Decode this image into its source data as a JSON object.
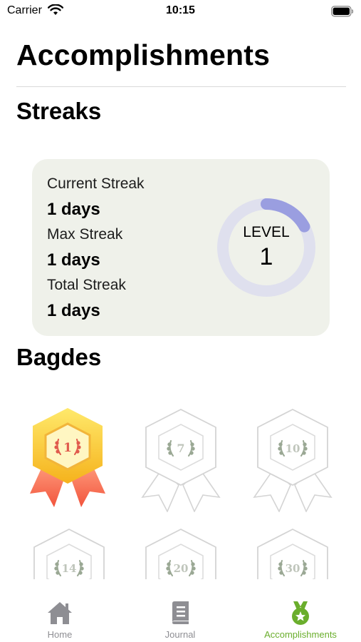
{
  "status_bar": {
    "carrier": "Carrier",
    "time": "10:15"
  },
  "title": "Accomplishments",
  "streaks": {
    "section_title": "Streaks",
    "current_label": "Current Streak",
    "current_value": "1 days",
    "max_label": "Max Streak",
    "max_value": "1 days",
    "total_label": "Total Streak",
    "total_value": "1 days",
    "level_label": "LEVEL",
    "level_value": "1",
    "level_progress": 0.17,
    "ring_track_color": "#dfe0ee",
    "ring_progress_color": "#9a9ee0"
  },
  "badges": {
    "section_title": "Bagdes",
    "items": [
      {
        "number": "1",
        "earned": true,
        "icon": "medal-icon"
      },
      {
        "number": "7",
        "earned": false,
        "icon": "medal-icon"
      },
      {
        "number": "10",
        "earned": false,
        "icon": "medal-icon"
      },
      {
        "number": "14",
        "earned": false,
        "icon": "medal-icon"
      },
      {
        "number": "20",
        "earned": false,
        "icon": "medal-icon"
      },
      {
        "number": "30",
        "earned": false,
        "icon": "medal-icon"
      }
    ]
  },
  "tab_bar": {
    "active_color": "#6aae2c",
    "inactive_color": "#8e8e93",
    "home": "Home",
    "journal": "Journal",
    "accomplishments": "Accomplishments"
  }
}
